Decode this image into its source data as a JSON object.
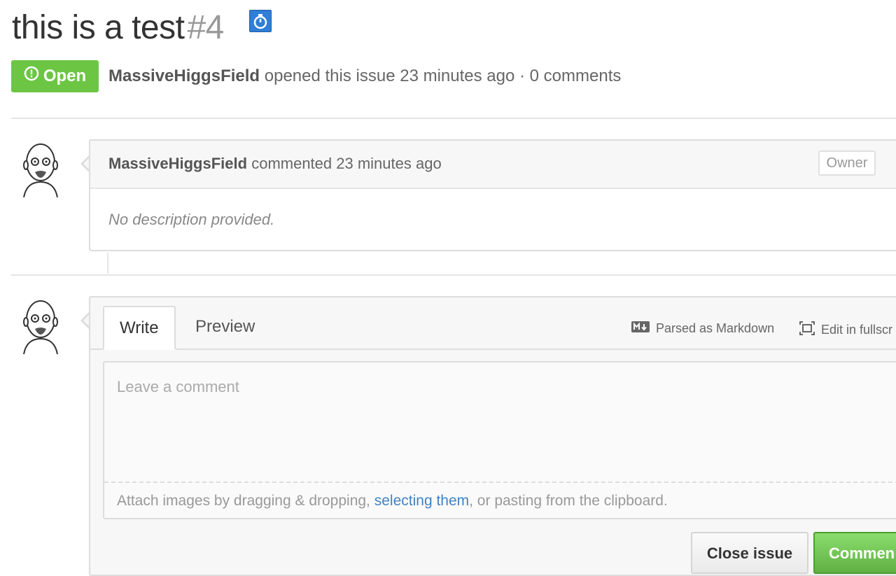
{
  "issue": {
    "title": "this is a test",
    "number": "#4",
    "state": "Open",
    "author": "MassiveHiggsField",
    "opened_text": "opened this issue 23 minutes ago · 0 comments"
  },
  "comment": {
    "author": "MassiveHiggsField",
    "action": "commented 23 minutes ago",
    "role": "Owner",
    "body": "No description provided."
  },
  "composer": {
    "tabs": [
      "Write",
      "Preview"
    ],
    "markdown_hint": "Parsed as Markdown",
    "fullscreen": "Edit in fullscr",
    "placeholder": "Leave a comment",
    "attach_prefix": "Attach images by dragging & dropping, ",
    "attach_link": "selecting them",
    "attach_suffix": ", or pasting from the clipboard.",
    "close_button": "Close issue",
    "comment_button": "Commen"
  },
  "colors": {
    "open_green": "#6cc644",
    "link_blue": "#4183c4"
  },
  "icons": [
    "stopwatch-icon",
    "issue-opened-icon",
    "markdown-icon",
    "fullscreen-icon",
    "avatar"
  ]
}
